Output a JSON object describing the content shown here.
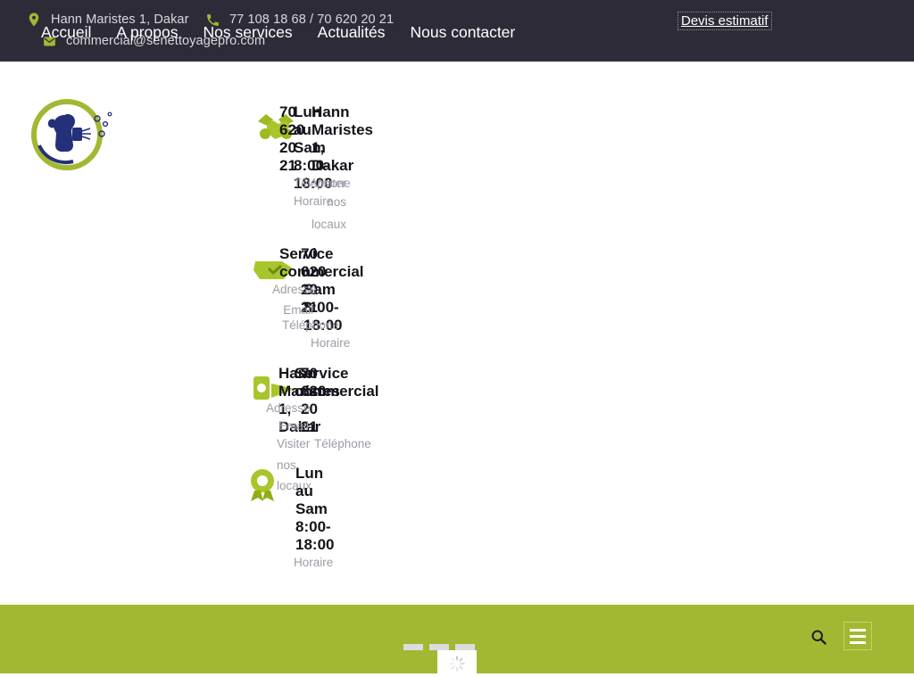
{
  "topbar": {
    "address": "Hann Maristes 1, Dakar",
    "phone": "77 108 18 68 / 70 620 20 21",
    "email": "commercial@senettoyagepro.com",
    "quote_link": "Devis estimatif",
    "bg_color": "#2e2b38",
    "icons": {
      "address": "map-marker-icon",
      "phone": "phone-icon",
      "email": "email-icon"
    }
  },
  "logo": {
    "alt": "Senettoyagepro logo",
    "ring_color": "#a2b832",
    "figure_color": "#24307a"
  },
  "info_blocks": [
    {
      "icon": "handshake-icon",
      "bold_lines": [
        "70",
        "620",
        "20",
        "21"
      ],
      "label": "Téléphone"
    },
    {
      "icon": "clock-icon",
      "bold_lines": [
        "Lun",
        "au",
        "Sam",
        "8:00-",
        "18:00"
      ],
      "label": "Horaire"
    },
    {
      "icon": "location-icon",
      "bold_lines": [
        "Hann",
        "Maristes",
        "1,",
        "Dakar"
      ],
      "label": "Visiter nos locaux"
    },
    {
      "icon": "envelope-icon",
      "bold_lines": [
        "Service",
        "commercial"
      ],
      "label": "Adresse"
    },
    {
      "icon": "mail-open-icon",
      "bold_lines": [
        "70",
        "620",
        "20",
        "21"
      ],
      "label": "Email"
    },
    {
      "icon": "award-badge-icon",
      "bold_lines": [
        "Lun",
        "au",
        "Sam",
        "8:00-",
        "18:00"
      ],
      "label": "Horaire"
    }
  ],
  "overlay_text": {
    "col_a_bold": [
      "70",
      "620",
      "20",
      "21"
    ],
    "col_b_bold": [
      "Lun",
      "au",
      "Sam",
      "8:00-",
      "18:00"
    ],
    "col_c_bold": [
      "Hann",
      "Maristes",
      "1,",
      "Dakar"
    ],
    "service_bold": [
      "Service",
      "commercial"
    ],
    "labels": {
      "telephone": "Téléphone",
      "horaire": "Horaire",
      "visiter": "Visiter",
      "nos": "nos",
      "locaux": "locaux",
      "adresse": "Adresse",
      "email": "Email"
    }
  },
  "footer": {
    "bg_color": "#a2b832",
    "nav": [
      {
        "label": "Accueil"
      },
      {
        "label": "A propos"
      },
      {
        "label": "Nos services"
      },
      {
        "label": "Actualités"
      },
      {
        "label": "Nous contacter"
      }
    ],
    "search_icon": "search-icon",
    "menu_icon": "hamburger-menu-icon"
  },
  "loading": {
    "spinner_icon": "loading-spinner-icon",
    "placeholder_count": 3
  }
}
